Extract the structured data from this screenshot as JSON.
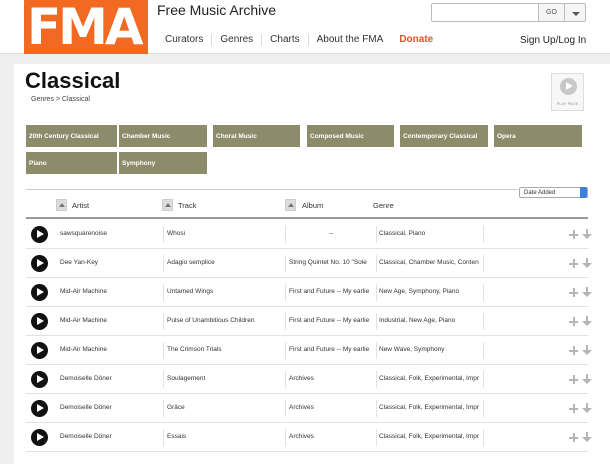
{
  "header": {
    "logo_text": "FMA",
    "site_title": "Free Music Archive",
    "nav": [
      "Curators",
      "Genres",
      "Charts",
      "About the FMA",
      "Donate"
    ],
    "search": {
      "value": "",
      "go_label": "GO"
    },
    "signup_label": "Sign Up/Log In"
  },
  "page": {
    "title": "Classical",
    "breadcrumb": "Genres > Classical",
    "play_page_label": "PLAY PAGE",
    "genre_tags": [
      "20th Century Classical",
      "Chamber Music",
      "Choral Music",
      "Composed Music",
      "Contemporary Classical",
      "Opera",
      "Piano",
      "Symphony"
    ],
    "sort_value": "Date Added"
  },
  "table": {
    "columns": [
      "Artist",
      "Track",
      "Album",
      "Genre"
    ],
    "rows": [
      {
        "artist": "sawsquarenoise",
        "track": "Whosi",
        "album": "--",
        "genre": "Classical, Piano"
      },
      {
        "artist": "Dee Yan-Key",
        "track": "Adagio semplice",
        "album": "String Quintet No. 10 \"Sole",
        "genre": "Classical, Chamber Music, Conten"
      },
      {
        "artist": "Mid-Air Machine",
        "track": "Untamed Wings",
        "album": "First and Future -- My earlie",
        "genre": "New Age, Symphony, Piano"
      },
      {
        "artist": "Mid-Air Machine",
        "track": "Pulse of Unambitious Children",
        "album": "First and Future -- My earlie",
        "genre": "Industrial, New Age, Piano"
      },
      {
        "artist": "Mid-Air Machine",
        "track": "The Crimson Trials",
        "album": "First and Future -- My earlie",
        "genre": "New Wave, Symphony"
      },
      {
        "artist": "Demoiselle Döner",
        "track": "Soulagement",
        "album": "Archives",
        "genre": "Classical, Folk, Experimental, Impr"
      },
      {
        "artist": "Demoiselle Döner",
        "track": "Grâce",
        "album": "Archives",
        "genre": "Classical, Folk, Experimental, Impr"
      },
      {
        "artist": "Demoiselle Döner",
        "track": "Essais",
        "album": "Archives",
        "genre": "Classical, Folk, Experimental, Impr"
      }
    ]
  },
  "colors": {
    "brand": "#f26922",
    "tag_bg": "#8d8c6a",
    "donate": "#e0522a"
  },
  "icons": {
    "play": "play-icon",
    "add": "plus-icon",
    "download": "download-arrow-icon",
    "sort": "sort-up-icon"
  }
}
